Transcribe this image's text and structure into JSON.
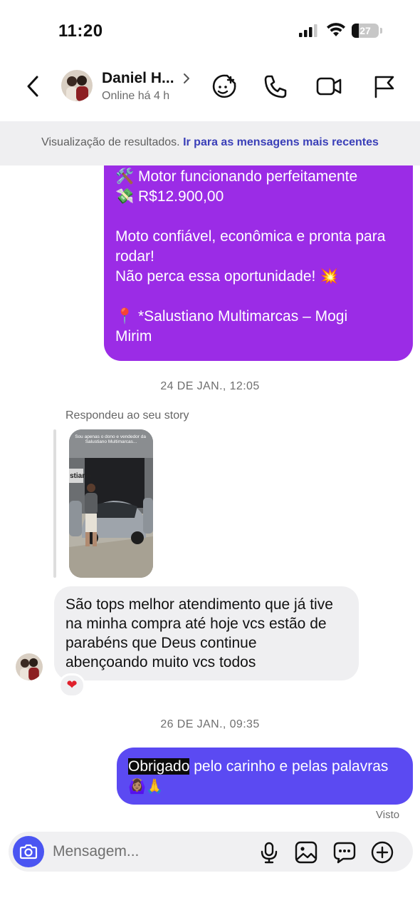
{
  "status_bar": {
    "time": "11:20",
    "battery": "27",
    "battery_level": 0.27
  },
  "header": {
    "contact_name": "Daniel H...",
    "contact_status": "Online há 4 h",
    "icons": [
      "back-icon",
      "chevron-right-icon",
      "sticker-icon",
      "phone-icon",
      "video-icon",
      "flag-icon"
    ]
  },
  "banner": {
    "text": "Visualização de resultados.",
    "link": "Ir para as mensagens mais recentes"
  },
  "messages": {
    "sent_top": {
      "line1": "🛠️ Motor funcionando perfeitamente",
      "line2": "💸 R$12.900,00",
      "line3": "Moto confiável, econômica e pronta para",
      "line4": "rodar!",
      "line5": "Não perca essa oportunidade! 💥",
      "line6": "📍 *Salustiano Multimarcas – Mogi",
      "line7": "Mirim"
    },
    "timestamp1": "24 DE JAN., 12:05",
    "reply_label": "Respondeu ao seu story",
    "story": {
      "caption": "Sou apenas o dono e vendedor da Salustiano Multimarcas...",
      "sign": "stiano"
    },
    "received": {
      "line1": "São tops melhor atendimento que já tive",
      "line2": "na minha compra até hoje vcs estão de",
      "line3": "parabéns que Deus continue",
      "line4": "abençoando muito vcs todos",
      "reaction": "❤"
    },
    "timestamp2": "26 DE JAN., 09:35",
    "sent_bottom": {
      "highlight": "Obrigado",
      "rest": " pelo carinho e pelas palavras",
      "emojis": "🙆🏽‍♀️🙏"
    },
    "seen": "Visto"
  },
  "composer": {
    "placeholder": "Mensagem..."
  },
  "colors": {
    "sent_purple": "#9b2ce6",
    "sent_blue": "#5b4af2",
    "link": "#3a3fb8",
    "camera_button": "#4a55f2"
  }
}
